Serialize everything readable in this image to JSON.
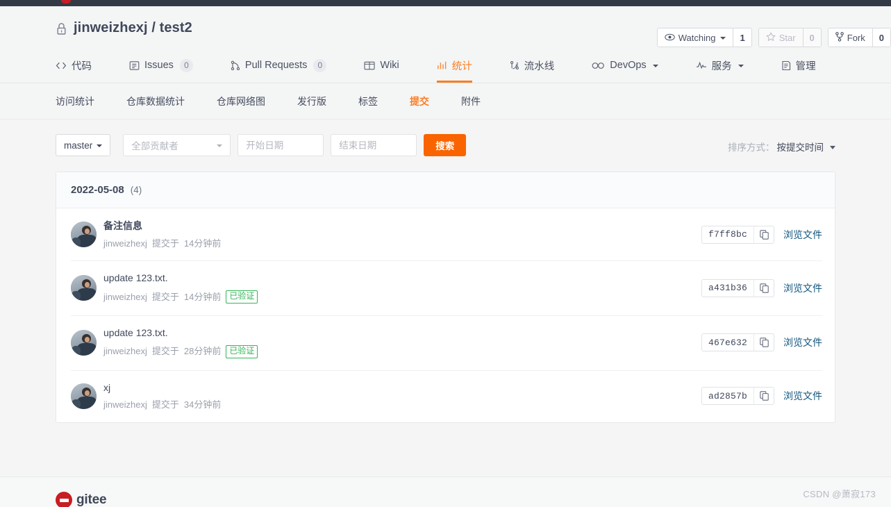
{
  "repo": {
    "owner": "jinweizhexj",
    "name": "test2",
    "title": "jinweizhexj / test2",
    "visibility_icon": "lock-icon",
    "actions": [
      {
        "id": "watch",
        "icon": "eye-icon",
        "label": "Watching",
        "count": "1",
        "has_caret": true,
        "disabled": false
      },
      {
        "id": "star",
        "icon": "star-icon",
        "label": "Star",
        "count": "0",
        "has_caret": false,
        "disabled": true
      },
      {
        "id": "fork",
        "icon": "fork-icon",
        "label": "Fork",
        "count": "0",
        "has_caret": false,
        "disabled": false
      }
    ]
  },
  "main_nav": [
    {
      "id": "code",
      "icon": "code-icon",
      "label": "代码",
      "badge": null,
      "active": false,
      "caret": false
    },
    {
      "id": "issues",
      "icon": "issue-icon",
      "label": "Issues",
      "badge": "0",
      "active": false,
      "caret": false
    },
    {
      "id": "pull-requests",
      "icon": "pull-request-icon",
      "label": "Pull Requests",
      "badge": "0",
      "active": false,
      "caret": false
    },
    {
      "id": "wiki",
      "icon": "book-icon",
      "label": "Wiki",
      "badge": null,
      "active": false,
      "caret": false
    },
    {
      "id": "statistics",
      "icon": "chart-icon",
      "label": "统计",
      "badge": null,
      "active": true,
      "caret": false
    },
    {
      "id": "pipeline",
      "icon": "pipeline-icon",
      "label": "流水线",
      "badge": null,
      "active": false,
      "caret": false
    },
    {
      "id": "devops",
      "icon": "infinity-icon",
      "label": "DevOps",
      "badge": null,
      "active": false,
      "caret": true
    },
    {
      "id": "service",
      "icon": "pulse-icon",
      "label": "服务",
      "badge": null,
      "active": false,
      "caret": true
    },
    {
      "id": "manage",
      "icon": "clipboard-icon",
      "label": "管理",
      "badge": null,
      "active": false,
      "caret": false
    }
  ],
  "sub_nav": [
    {
      "id": "visits",
      "label": "访问统计",
      "active": false
    },
    {
      "id": "repo-data",
      "label": "仓库数据统计",
      "active": false
    },
    {
      "id": "network",
      "label": "仓库网络图",
      "active": false
    },
    {
      "id": "releases",
      "label": "发行版",
      "active": false
    },
    {
      "id": "tags",
      "label": "标签",
      "active": false
    },
    {
      "id": "commits",
      "label": "提交",
      "active": true
    },
    {
      "id": "attachments",
      "label": "附件",
      "active": false
    }
  ],
  "filters": {
    "branch": "master",
    "contributor_placeholder": "全部贡献者",
    "start_date_placeholder": "开始日期",
    "start_date_value": "",
    "end_date_placeholder": "结束日期",
    "end_date_value": "",
    "search_label": "搜索",
    "sort_label": "排序方式：",
    "sort_value": "按提交时间"
  },
  "commits_group": {
    "date": "2022-05-08",
    "count": "(4)",
    "browse_label": "浏览文件",
    "verified_label": "已验证",
    "rows": [
      {
        "message": "备注信息",
        "message_bold": true,
        "author": "jinweizhexj",
        "action": "提交于",
        "time": "14分钟前",
        "verified": false,
        "sha": "f7ff8bc"
      },
      {
        "message": "update 123.txt.",
        "message_bold": false,
        "author": "jinweizhexj",
        "action": "提交于",
        "time": "14分钟前",
        "verified": true,
        "sha": "a431b36"
      },
      {
        "message": "update 123.txt.",
        "message_bold": false,
        "author": "jinweizhexj",
        "action": "提交于",
        "time": "28分钟前",
        "verified": true,
        "sha": "467e632"
      },
      {
        "message": "xj",
        "message_bold": false,
        "author": "jinweizhexj",
        "action": "提交于",
        "time": "34分钟前",
        "verified": false,
        "sha": "ad2857b"
      }
    ]
  },
  "footer": {
    "brand": "gitee",
    "watermark": "CSDN @萧寂173"
  },
  "colors": {
    "accent_orange": "#fa7d22",
    "search_orange": "#fa6400",
    "link_blue": "#12567f",
    "verified_green": "#35b558",
    "brand_red": "#c71d23"
  }
}
